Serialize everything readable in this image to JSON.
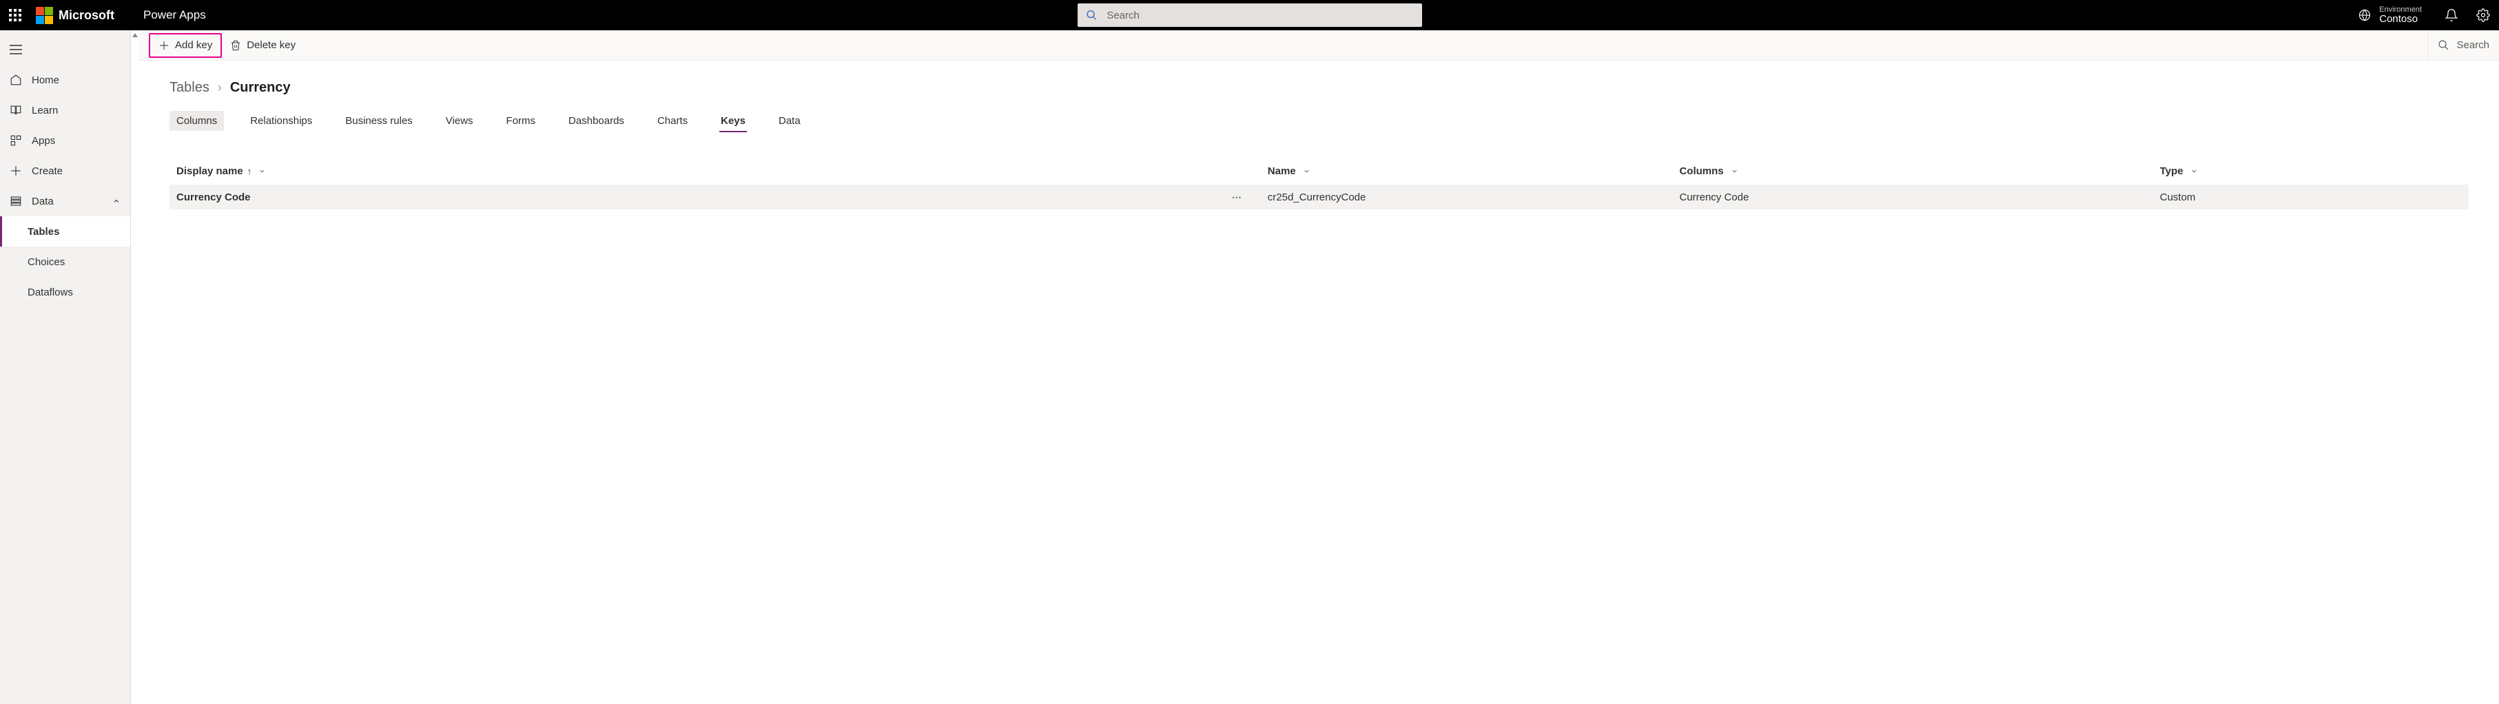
{
  "header": {
    "brand": "Microsoft",
    "appName": "Power Apps",
    "searchPlaceholder": "Search",
    "environment": {
      "label": "Environment",
      "name": "Contoso"
    }
  },
  "sidebar": {
    "home": "Home",
    "learn": "Learn",
    "apps": "Apps",
    "create": "Create",
    "data": "Data",
    "sub": {
      "tables": "Tables",
      "choices": "Choices",
      "dataflows": "Dataflows"
    }
  },
  "commandBar": {
    "addKey": "Add key",
    "deleteKey": "Delete key",
    "search": "Search"
  },
  "breadcrumb": {
    "parent": "Tables",
    "current": "Currency"
  },
  "tabs": {
    "columns": "Columns",
    "relationships": "Relationships",
    "businessRules": "Business rules",
    "views": "Views",
    "forms": "Forms",
    "dashboards": "Dashboards",
    "charts": "Charts",
    "keys": "Keys",
    "data": "Data"
  },
  "table": {
    "headers": {
      "displayName": "Display name",
      "name": "Name",
      "columns": "Columns",
      "type": "Type"
    },
    "rows": [
      {
        "displayName": "Currency Code",
        "name": "cr25d_CurrencyCode",
        "columns": "Currency Code",
        "type": "Custom"
      }
    ]
  }
}
